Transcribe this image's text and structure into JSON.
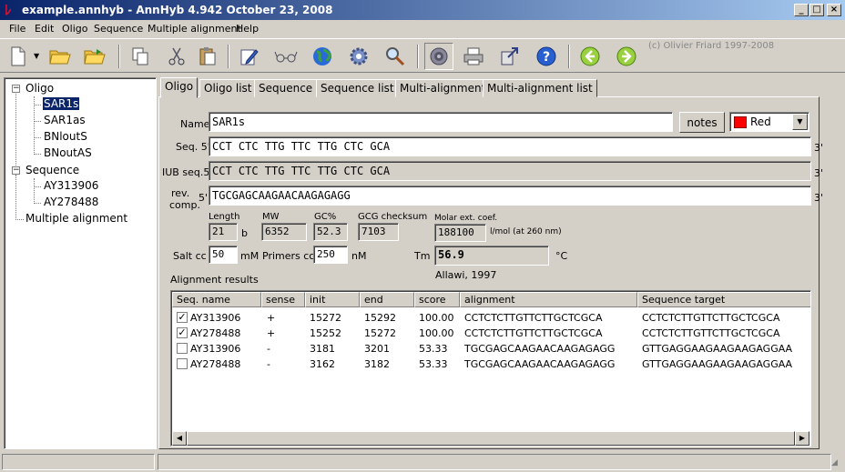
{
  "window": {
    "title": "example.annhyb - AnnHyb 4.942  October 23, 2008",
    "min_label": "_",
    "max_label": "□",
    "close_label": "×"
  },
  "menu": [
    "File",
    "Edit",
    "Oligo",
    "Sequence",
    "Multiple alignment",
    "Help"
  ],
  "toolbar": {
    "icons": [
      "new-file-icon",
      "open-folder-icon",
      "open-folder-arrow-icon",
      "copy-icon",
      "cut-icon",
      "paste-icon",
      "edit-pencil-icon",
      "glasses-icon",
      "globe-icon",
      "settings-gear-icon",
      "search-magnifier-icon",
      "speaker-icon",
      "printer-icon",
      "export-icon",
      "help-icon",
      "back-arrow-icon",
      "forward-arrow-icon"
    ],
    "copyright": "(c) Olivier Friard 1997-2008"
  },
  "tree": {
    "oligo": "Oligo",
    "oligo_items": [
      "SAR1s",
      "SAR1as",
      "BNloutS",
      "BNoutAS"
    ],
    "sequence": "Sequence",
    "sequence_items": [
      "AY313906",
      "AY278488"
    ],
    "multiple_alignment": "Multiple alignment"
  },
  "tabs": [
    "Oligo",
    "Oligo list",
    "Sequence",
    "Sequence list",
    "Multi-alignment",
    "Multi-alignment list"
  ],
  "oligo": {
    "name_label": "Name",
    "name_value": "SAR1s",
    "notes_label": "notes",
    "color_value": "Red",
    "color_hex": "#ff0000",
    "seq5_label": "Seq. 5'",
    "seq5_value": "CCT CTC TTG TTC TTG CTC GCA",
    "iub_label": "IUB seq.5'",
    "iub_value": "CCT CTC TTG TTC TTG CTC GCA",
    "rev_label_1": "rev.",
    "rev_label_2": "comp.",
    "rev_5": "5'",
    "rev_value": "TGCGAGCAAGAACAAGAGAGG",
    "three_prime": "3'",
    "length_label": "Length",
    "length_value": "21",
    "length_unit": "b",
    "mw_label": "MW",
    "mw_value": "6352",
    "gc_label": "GC%",
    "gc_value": "52.3",
    "gcg_label": "GCG checksum",
    "gcg_value": "7103",
    "molar_label": "Molar ext. coef.",
    "molar_value": "188100",
    "molar_unit": "l/mol (at 260 nm)",
    "salt_label": "Salt cc",
    "salt_value": "50",
    "salt_unit": "mM",
    "primers_label": "Primers cc",
    "primers_value": "250",
    "primers_unit": "nM",
    "tm_label": "Tm",
    "tm_value": "56.9",
    "tm_unit": "°C",
    "method": "Allawi, 1997",
    "results_label": "Alignment results"
  },
  "grid": {
    "headers": [
      "Seq. name",
      "sense",
      "init",
      "end",
      "score",
      "alignment",
      "Sequence target"
    ],
    "rows": [
      {
        "checked": true,
        "name": "AY313906",
        "sense": "+",
        "init": "15272",
        "end": "15292",
        "score": "100.00",
        "alignment": "CCTCTCTTGTTCTTGCTCGCA",
        "target": "CCTCTCTTGTTCTTGCTCGCA"
      },
      {
        "checked": true,
        "name": "AY278488",
        "sense": "+",
        "init": "15252",
        "end": "15272",
        "score": "100.00",
        "alignment": "CCTCTCTTGTTCTTGCTCGCA",
        "target": "CCTCTCTTGTTCTTGCTCGCA"
      },
      {
        "checked": false,
        "name": "AY313906",
        "sense": "-",
        "init": "3181",
        "end": "3201",
        "score": "53.33",
        "alignment": "TGCGAGCAAGAACAAGAGAGG",
        "target": "GTTGAGGAAGAAGAAGAGGAA"
      },
      {
        "checked": false,
        "name": "AY278488",
        "sense": "-",
        "init": "3162",
        "end": "3182",
        "score": "53.33",
        "alignment": "TGCGAGCAAGAACAAGAGAGG",
        "target": "GTTGAGGAAGAAGAAGAGGAA"
      }
    ]
  }
}
